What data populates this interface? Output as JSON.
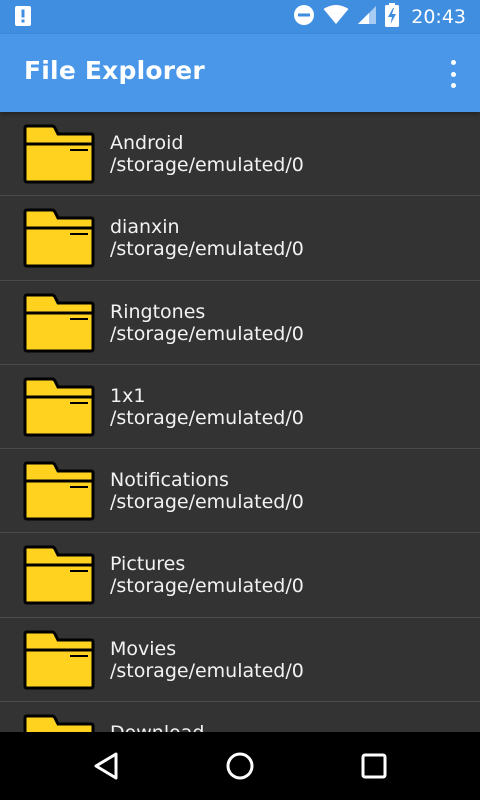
{
  "status_bar": {
    "time": "20:43",
    "icons": [
      "notification-alert-icon",
      "do-not-disturb-icon",
      "wifi-icon",
      "cell-signal-icon",
      "battery-charging-icon"
    ]
  },
  "app_bar": {
    "title": "File Explorer",
    "overflow_icon": "more-vert-icon"
  },
  "files": [
    {
      "name": "Android",
      "path": "/storage/emulated/0"
    },
    {
      "name": "dianxin",
      "path": "/storage/emulated/0"
    },
    {
      "name": "Ringtones",
      "path": "/storage/emulated/0"
    },
    {
      "name": "1x1",
      "path": "/storage/emulated/0"
    },
    {
      "name": "Notifications",
      "path": "/storage/emulated/0"
    },
    {
      "name": "Pictures",
      "path": "/storage/emulated/0"
    },
    {
      "name": "Movies",
      "path": "/storage/emulated/0"
    },
    {
      "name": "Download",
      "path": ""
    }
  ],
  "nav_bar": {
    "icons": [
      "back-icon",
      "home-icon",
      "recents-icon"
    ]
  },
  "colors": {
    "status_bar": "#3f8ee0",
    "app_bar": "#4a97ea",
    "list_background": "#333333",
    "folder_fill": "#ffd21f",
    "folder_outline": "#000000",
    "text": "#f2f2f2"
  }
}
